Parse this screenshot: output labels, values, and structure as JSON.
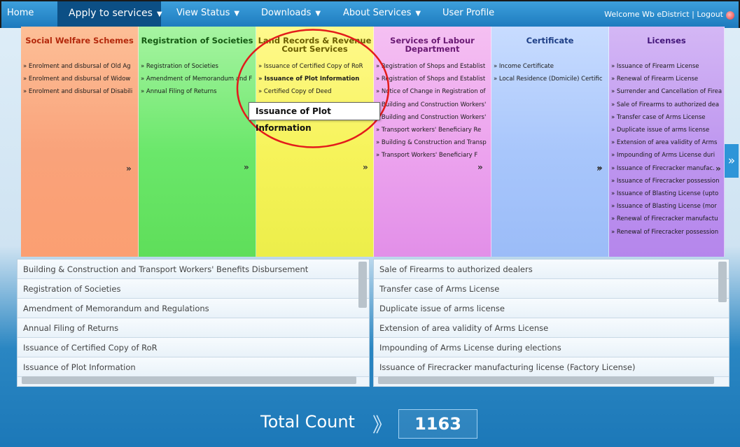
{
  "nav": {
    "home": "Home",
    "apply": "Apply to services",
    "view_status": "View Status",
    "downloads": "Downloads",
    "about": "About Services",
    "profile": "User Profile",
    "welcome": "Welcome Wb eDistrict",
    "separator": "|",
    "logout": "Logout"
  },
  "panels": [
    {
      "title": "Social Welfare Schemes",
      "color": "#f9a27a",
      "items": [
        "Enrolment and disbursal of Old Ag",
        "Enrolment and disbursal of Widow",
        "Enrolment and disbursal of Disabili"
      ]
    },
    {
      "title": "Registration of Societies",
      "color": "#6ae76a",
      "items": [
        "Registration of Societies",
        "Amendment of Memorandum and F",
        "Annual Filing of Returns"
      ]
    },
    {
      "title": "Land Records & Revenue Court Services",
      "color": "#f6f35a",
      "items": [
        "Issuance of Certified Copy of RoR",
        "Issuance of Plot Information",
        "Certified Copy of Deed"
      ]
    },
    {
      "title": "Services of Labour Department",
      "color": "#eca3ee",
      "items": [
        "Registration of Shops and Establist",
        "Registration of Shops and Establist",
        "Notice of Change in Registration of",
        "Building and Construction Workers'",
        "Building and Construction Workers'",
        "Transport workers' Beneficiary Re",
        "Building & Construction and Transp",
        "Transport Workers' Beneficiary F"
      ]
    },
    {
      "title": "Certificate",
      "color": "#a8c6fb",
      "items": [
        "Income Certificate",
        "Local Residence (Domicile) Certific"
      ]
    },
    {
      "title": "Licenses",
      "color": "#be96ef",
      "items": [
        "Issuance of Firearm License",
        "Renewal of Firearm License",
        "Surrender and Cancellation of Firea",
        "Sale of Firearms to authorized dea",
        "Transfer case of Arms License",
        "Duplicate issue of arms license",
        "Extension of area validity of Arms",
        "Impounding of Arms License duri",
        "Issuance of Firecracker manufac.",
        "Issuance of Firecracker possession",
        "Issuance of Blasting License (upto",
        "Issuance of Blasting License (mor",
        "Renewal of Firecracker manufactu",
        "Renewal of Firecracker possession"
      ]
    }
  ],
  "more_glyph": "»",
  "side_arrow": "»",
  "tooltip": "Issuance of Plot Information",
  "left_list": [
    "Building & Construction and Transport Workers' Benefits Disbursement",
    "Registration of Societies",
    "Amendment of Memorandum and Regulations",
    "Annual Filing of Returns",
    "Issuance of Certified Copy of RoR",
    "Issuance of Plot Information"
  ],
  "right_list": [
    "Sale of Firearms to authorized dealers",
    "Transfer case of Arms License",
    "Duplicate issue of arms license",
    "Extension of area validity of Arms License",
    "Impounding of Arms License during elections",
    "Issuance of Firecracker manufacturing license (Factory License)"
  ],
  "total": {
    "label": "Total Count",
    "chevron": "》",
    "value": "1163"
  }
}
